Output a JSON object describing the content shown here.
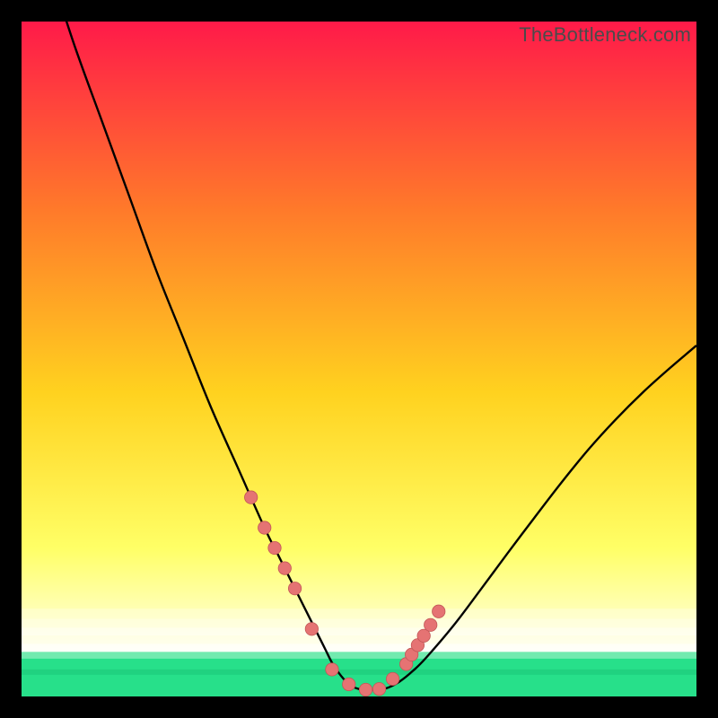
{
  "watermark": "TheBottleneck.com",
  "colors": {
    "bg_black": "#000000",
    "grad_top": "#ff1a49",
    "grad_mid1": "#ff7a2a",
    "grad_mid2": "#ffd21f",
    "grad_low": "#ffff66",
    "grad_pale": "#ffffcc",
    "grad_green": "#27e08a",
    "curve": "#000000",
    "marker_fill": "#e57373",
    "marker_stroke": "#c25757"
  },
  "chart_data": {
    "type": "line",
    "title": "",
    "xlabel": "",
    "ylabel": "",
    "xlim": [
      0,
      100
    ],
    "ylim": [
      0,
      100
    ],
    "grid": false,
    "legend": false,
    "series": [
      {
        "name": "bottleneck-curve",
        "x": [
          0,
          4,
          8,
          12,
          16,
          20,
          24,
          28,
          32,
          36,
          38,
          40,
          42,
          43,
          44,
          45,
          46,
          47,
          48,
          49,
          50,
          51,
          52,
          54,
          56,
          58,
          60,
          64,
          68,
          72,
          76,
          80,
          84,
          88,
          92,
          96,
          100
        ],
        "y": [
          118,
          108,
          96,
          85,
          74,
          63,
          53,
          43,
          34,
          25,
          21,
          17,
          13,
          11,
          9,
          7,
          5,
          3.5,
          2.3,
          1.5,
          1.1,
          1.0,
          1.0,
          1.2,
          2.2,
          3.8,
          5.8,
          10.5,
          15.8,
          21.2,
          26.5,
          31.7,
          36.6,
          41.0,
          45.0,
          48.6,
          52.0
        ]
      }
    ],
    "markers": {
      "name": "highlight-points",
      "x": [
        34,
        36,
        37.5,
        39,
        40.5,
        43,
        46,
        48.5,
        51,
        53,
        55,
        57,
        57.8,
        58.7,
        59.6,
        60.6,
        61.8
      ],
      "y": [
        29.5,
        25.0,
        22.0,
        19.0,
        16.0,
        10.0,
        4.0,
        1.8,
        1.0,
        1.1,
        2.6,
        4.8,
        6.2,
        7.6,
        9.0,
        10.6,
        12.6
      ]
    },
    "gradient_stops": [
      {
        "pct": 0,
        "color": "#ff1a49"
      },
      {
        "pct": 28,
        "color": "#ff7a2a"
      },
      {
        "pct": 55,
        "color": "#ffd21f"
      },
      {
        "pct": 78,
        "color": "#ffff66"
      },
      {
        "pct": 90,
        "color": "#ffffcc"
      },
      {
        "pct": 95,
        "color": "#ffffff"
      },
      {
        "pct": 100,
        "color": "#27e08a"
      }
    ]
  }
}
